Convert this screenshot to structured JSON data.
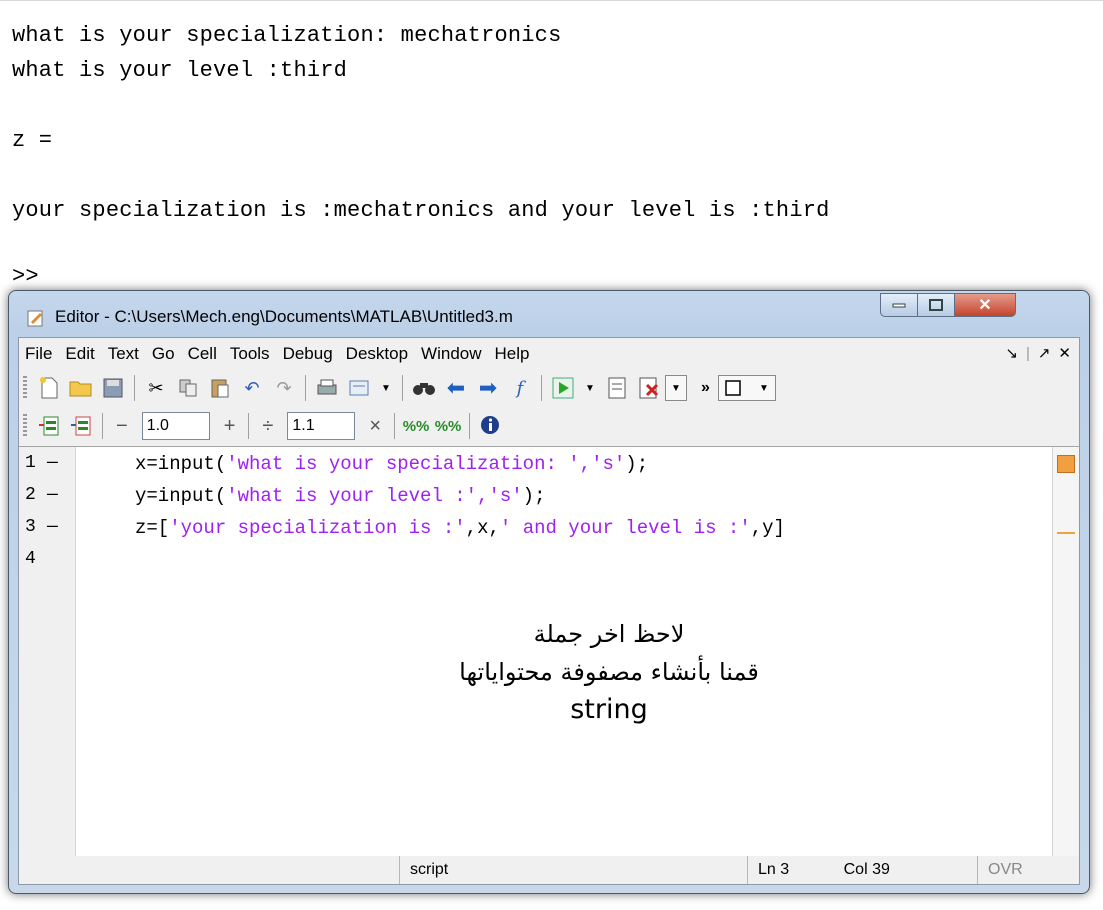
{
  "command_window": {
    "lines": [
      "what is your specialization: mechatronics",
      "what is your level :third",
      "",
      "z =",
      "",
      "your specialization is :mechatronics and your level is :third",
      "",
      ">>"
    ]
  },
  "editor": {
    "title": "Editor - C:\\Users\\Mech.eng\\Documents\\MATLAB\\Untitled3.m",
    "menu": [
      "File",
      "Edit",
      "Text",
      "Go",
      "Cell",
      "Tools",
      "Debug",
      "Desktop",
      "Window",
      "Help"
    ],
    "toolbar2": {
      "cell_minus": "−",
      "cell_value1": "1.0",
      "cell_plus": "+",
      "cell_divide": "÷",
      "cell_value2": "1.1",
      "cell_times": "×"
    },
    "code": {
      "line_numbers": [
        "1",
        "2",
        "3",
        "4"
      ],
      "line1": {
        "pre": "x=input(",
        "str": "'what is your specialization: ','s'",
        "post": ");"
      },
      "line2": {
        "pre": "y=input(",
        "str": "'what is your level :','s'",
        "post": ");"
      },
      "line3": {
        "pre": "z=[",
        "s1": "'your specialization is :'",
        "mid": ",x,",
        "s2": "' and your level is :'",
        "post": ",y]"
      }
    },
    "annotation": [
      "لاحظ اخر جملة",
      "قمنا بأنشاء مصفوفة محتواياتها",
      "string"
    ],
    "status": {
      "mode": "script",
      "ln_label": "Ln",
      "ln": "3",
      "col_label": "Col",
      "col": "39",
      "ovr": "OVR"
    }
  }
}
